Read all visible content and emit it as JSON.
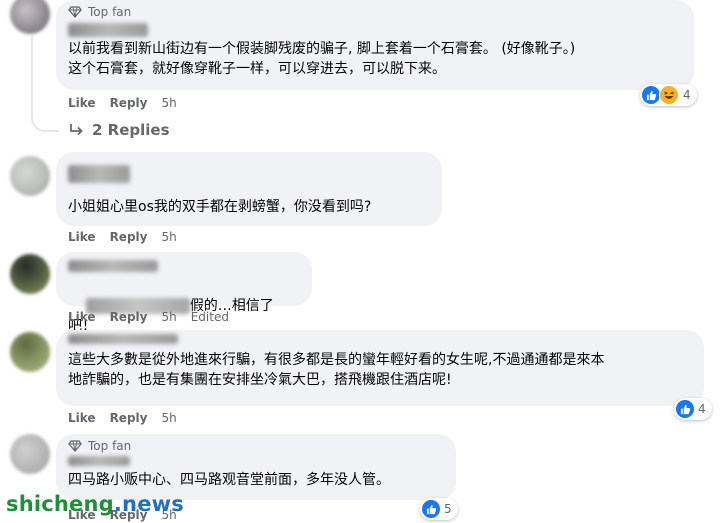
{
  "comments": [
    {
      "badge": "Top fan",
      "text": "以前我看到新山街边有一个假装脚残废的骗子, 脚上套着一个石膏套。 (好像靴子。)\n这个石膏套，就好像穿靴子一样，可以穿进去，可以脱下来。",
      "like": "Like",
      "reply": "Reply",
      "time": "5h",
      "reaction_count": "4",
      "reaction_icons": [
        "like-icon",
        "haha-icon"
      ]
    },
    {
      "text": "小姐姐心里os我的双手都在剥螃蟹，你没看到吗?",
      "like": "Like",
      "reply": "Reply",
      "time": "5h"
    },
    {
      "text_suffix": "假的…相信了吧！",
      "like": "Like",
      "reply": "Reply",
      "time": "5h",
      "edited": "Edited"
    },
    {
      "text": "這些大多數是從外地進來行騙，有很多都是長的蠻年輕好看的女生呢,不過通通都是來本\n地詐騙的，也是有集團在安排坐冷氣大巴，搭飛機跟住酒店呢!",
      "like": "Like",
      "reply": "Reply",
      "time": "5h",
      "reaction_count": "4",
      "reaction_icons": [
        "like-icon"
      ]
    },
    {
      "badge": "Top fan",
      "text": "四马路小贩中心、四马路观音堂前面，多年没人管。",
      "like": "Like",
      "reply": "Reply",
      "time": "5h",
      "reaction_count": "5",
      "reaction_icons": [
        "like-icon"
      ]
    }
  ],
  "replies_link": "2 Replies",
  "watermark": {
    "part1": "shicheng",
    "part2": ".news"
  },
  "colors": {
    "bubble": "#f0f2f5",
    "meta": "#65676b",
    "like_blue": "#1877f2",
    "haha_yellow": "#f7b125"
  }
}
